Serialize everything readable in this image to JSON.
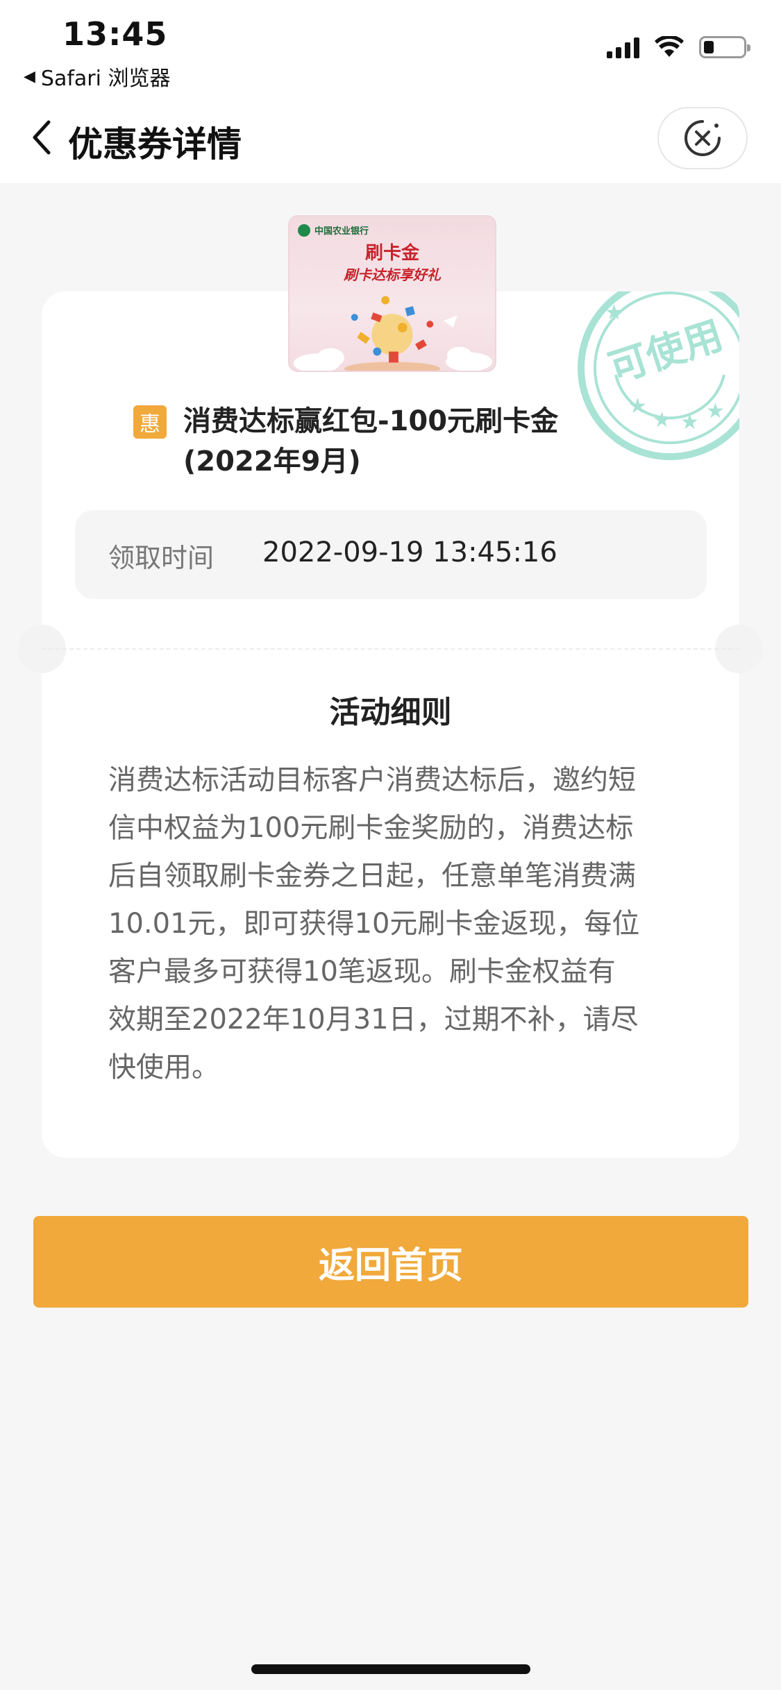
{
  "status_bar": {
    "time": "13:45",
    "back_app": "Safari 浏览器",
    "battery_level": 0.25
  },
  "nav": {
    "title": "优惠券详情"
  },
  "coupon": {
    "image": {
      "bank_name": "中国农业银行",
      "title": "刷卡金",
      "subtitle": "刷卡达标享好礼"
    },
    "stamp_text": "可使用",
    "badge": "惠",
    "title_line1": "消费达标赢红包-100元刷卡金",
    "title_line2": "(2022年9月)",
    "claim_label": "领取时间",
    "claim_time": "2022-09-19 13:45:16"
  },
  "rules": {
    "heading": "活动细则",
    "lines": [
      "消费达标活动目标客户消费达标后，邀约短",
      "信中权益为100元刷卡金奖励的，消费达标",
      "后自领取刷卡金券之日起，任意单笔消费满",
      "10.01元，即可获得10元刷卡金返现，每位",
      "客户最多可获得10笔返现。刷卡金权益有",
      "效期至2022年10月31日，过期不补，请尽",
      "快使用。"
    ]
  },
  "actions": {
    "home_label": "返回首页"
  },
  "colors": {
    "accent": "#f1a93b",
    "stamp": "#7fd6c2",
    "bank_green": "#1f8a4a"
  }
}
